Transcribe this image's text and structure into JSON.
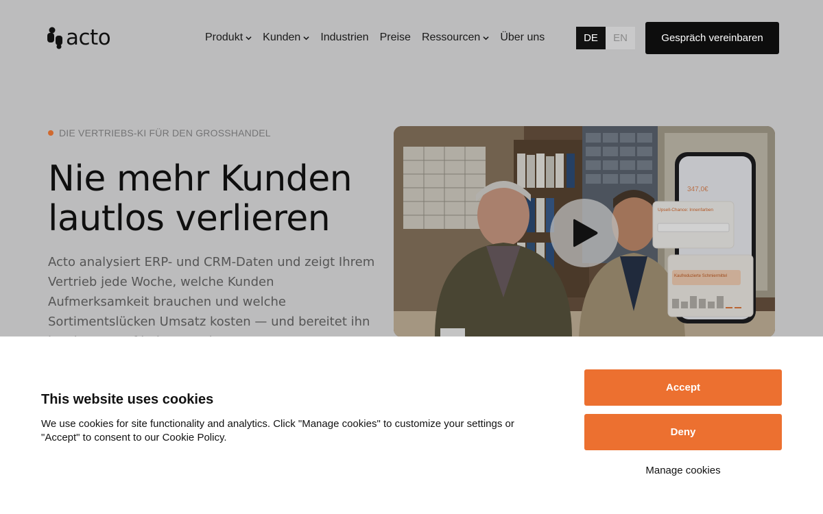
{
  "header": {
    "logo_text": "acto",
    "nav": [
      {
        "label": "Produkt",
        "has_dropdown": true
      },
      {
        "label": "Kunden",
        "has_dropdown": true
      },
      {
        "label": "Industrien",
        "has_dropdown": false
      },
      {
        "label": "Preise",
        "has_dropdown": false
      },
      {
        "label": "Ressourcen",
        "has_dropdown": true
      },
      {
        "label": "Über uns",
        "has_dropdown": false
      }
    ],
    "languages": [
      {
        "code": "DE",
        "active": true
      },
      {
        "code": "EN",
        "active": false
      }
    ],
    "cta_label": "Gespräch vereinbaren"
  },
  "hero": {
    "eyebrow": "DIE VERTRIEBS-KI FÜR DEN GROSSHANDEL",
    "headline_line1": "Nie mehr Kunden",
    "headline_line2": "lautlos verlieren",
    "subtext": "Acto analysiert ERP- und CRM-Daten und zeigt Ihrem Vertrieb jede Woche, welche Kunden Aufmerksamkeit brauchen und welche Sortimentslücken Umsatz kosten — und bereitet ihn in Minuten auf jeden Termin",
    "video_overlay": {
      "phone_amount": "347,0€",
      "upsell_title": "Upsell-Chance: Innenfarben",
      "promo_label": "Kaufreduzierte Schmiermittel"
    }
  },
  "cookie_banner": {
    "title": "This website uses cookies",
    "text": "We use cookies for site functionality and analytics. Click \"Manage cookies\" to customize your settings or \"Accept\" to consent to our Cookie Policy.",
    "accept_label": "Accept",
    "deny_label": "Deny",
    "manage_label": "Manage cookies"
  },
  "colors": {
    "accent_orange": "#ec7030",
    "dark": "#0d0d0d",
    "page_dim": "#bcbcbd"
  }
}
